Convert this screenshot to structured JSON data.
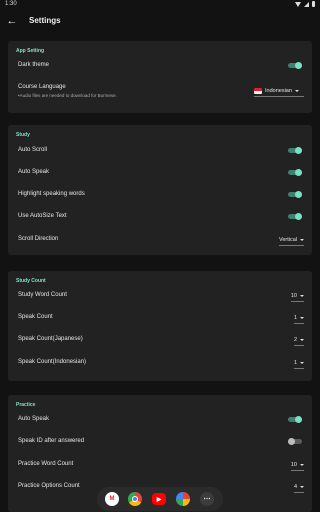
{
  "status_bar": {
    "time": "1:30"
  },
  "app_bar": {
    "title": "Settings"
  },
  "sections": {
    "app_setting": {
      "header": "App Setting",
      "dark_theme": {
        "label": "Dark theme",
        "on": true
      },
      "course_language": {
        "label": "Course Language",
        "note": "•Audio files are needed to download for Burmese.",
        "value": "Indonesian",
        "flag_icon": "indonesia-flag"
      }
    },
    "study": {
      "header": "Study",
      "auto_scroll": {
        "label": "Auto Scroll",
        "on": true
      },
      "auto_speak": {
        "label": "Auto Speak",
        "on": true
      },
      "highlight_speaking": {
        "label": "Highlight speaking words",
        "on": true
      },
      "autosize_text": {
        "label": "Use AutoSize Text",
        "on": true
      },
      "scroll_direction": {
        "label": "Scroll Direction",
        "value": "Vertical"
      }
    },
    "study_count": {
      "header": "Study Count",
      "word_count": {
        "label": "Study Word Count",
        "value": "10"
      },
      "speak_count": {
        "label": "Speak Count",
        "value": "1"
      },
      "speak_count_japanese": {
        "label": "Speak Count(Japanese)",
        "value": "2"
      },
      "speak_count_indonesian": {
        "label": "Speak Count(Indonesian)",
        "value": "1"
      }
    },
    "practice": {
      "header": "Practice",
      "auto_speak": {
        "label": "Auto Speak",
        "on": true
      },
      "speak_id_after": {
        "label": "Speak ID after answered",
        "on": false
      },
      "word_count": {
        "label": "Practice Word Count",
        "value": "10"
      },
      "options_count": {
        "label": "Practice Options Count",
        "value": "4"
      }
    }
  },
  "dock": {
    "apps": [
      "gmail-icon",
      "chrome-icon",
      "youtube-icon",
      "photos-icon",
      "app-drawer-icon"
    ]
  },
  "colors": {
    "accent": "#7fe3c8",
    "toggle_on": "#78e0c4",
    "card": "#222222",
    "background": "#121212"
  }
}
